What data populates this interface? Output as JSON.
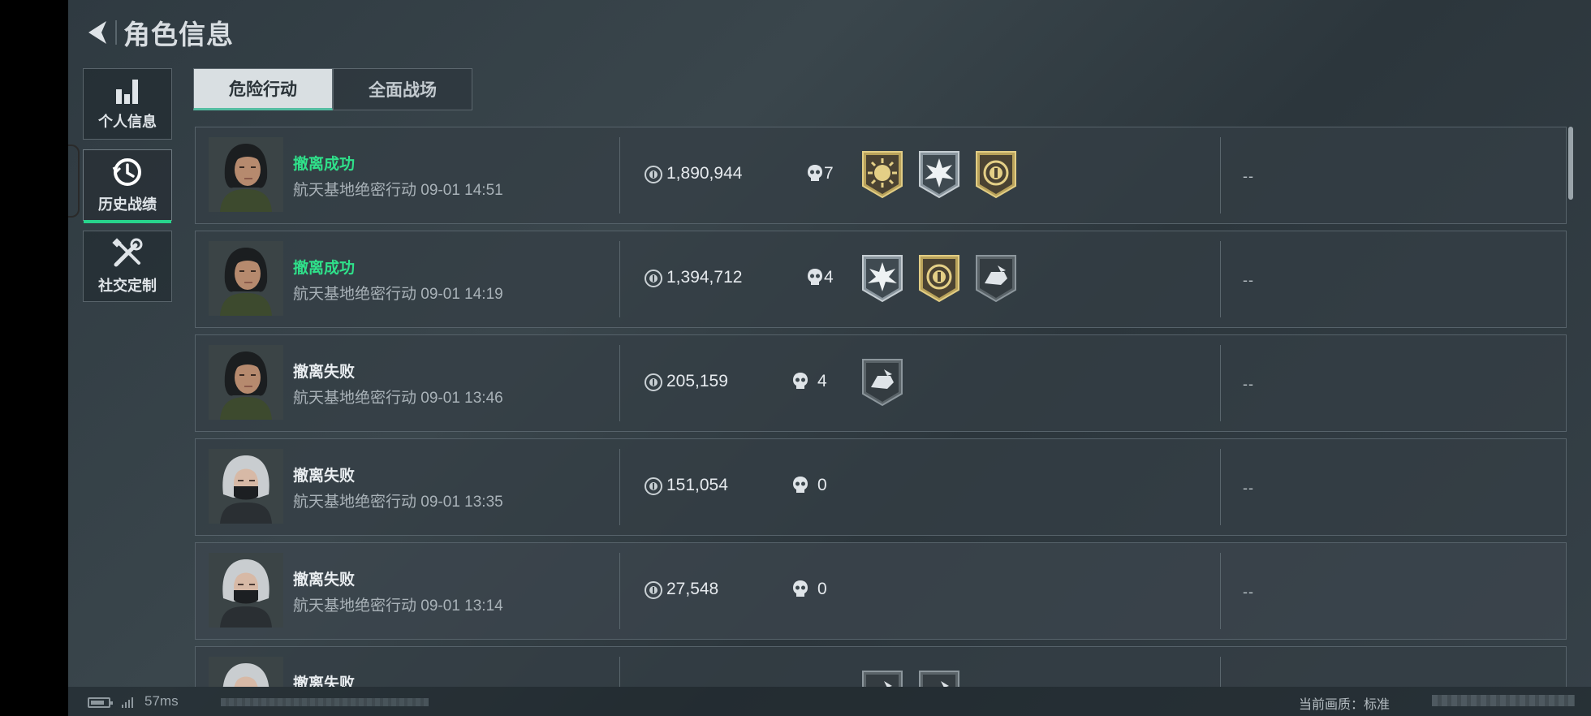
{
  "header": {
    "title": "角色信息"
  },
  "sidebar": {
    "items": [
      {
        "label": "个人信息",
        "icon": "bar-chart-icon"
      },
      {
        "label": "历史战绩",
        "icon": "history-clock-icon",
        "active": true
      },
      {
        "label": "社交定制",
        "icon": "tools-icon"
      }
    ]
  },
  "tabs": [
    {
      "label": "危险行动",
      "active": true
    },
    {
      "label": "全面战场",
      "active": false
    }
  ],
  "records": [
    {
      "status": "撤离成功",
      "success": true,
      "map": "航天基地绝密行动",
      "time": "09-01 14:51",
      "coins": "1,890,944",
      "kills": "7",
      "medals": [
        "gold-sun",
        "silver-star",
        "gold-coin"
      ],
      "extra": "--",
      "avatar": "female-dark-hair"
    },
    {
      "status": "撤离成功",
      "success": true,
      "map": "航天基地绝密行动",
      "time": "09-01 14:19",
      "coins": "1,394,712",
      "kills": "4",
      "medals": [
        "silver-star",
        "gold-coin",
        "dark-fist"
      ],
      "extra": "--",
      "avatar": "female-dark-hair"
    },
    {
      "status": "撤离失败",
      "success": false,
      "map": "航天基地绝密行动",
      "time": "09-01 13:46",
      "coins": "205,159",
      "kills": "4",
      "medals": [
        "dark-fist"
      ],
      "extra": "--",
      "avatar": "female-dark-hair"
    },
    {
      "status": "撤离失败",
      "success": false,
      "map": "航天基地绝密行动",
      "time": "09-01 13:35",
      "coins": "151,054",
      "kills": "0",
      "medals": [],
      "extra": "--",
      "avatar": "female-silver-hair-mask"
    },
    {
      "status": "撤离失败",
      "success": false,
      "map": "航天基地绝密行动",
      "time": "09-01 13:14",
      "coins": "27,548",
      "kills": "0",
      "medals": [],
      "extra": "--",
      "avatar": "female-silver-hair-mask"
    },
    {
      "status": "撤离失败",
      "success": false,
      "map": "",
      "time": "",
      "coins": "",
      "kills": "",
      "medals": [
        "dark-fist",
        "dark-fist"
      ],
      "extra": "",
      "avatar": "female-silver-hair-mask"
    }
  ],
  "footer": {
    "ping": "57ms",
    "quality": "当前画质：标准"
  },
  "colors": {
    "success": "#2fe08a",
    "accent_underline": "#27d48c"
  }
}
